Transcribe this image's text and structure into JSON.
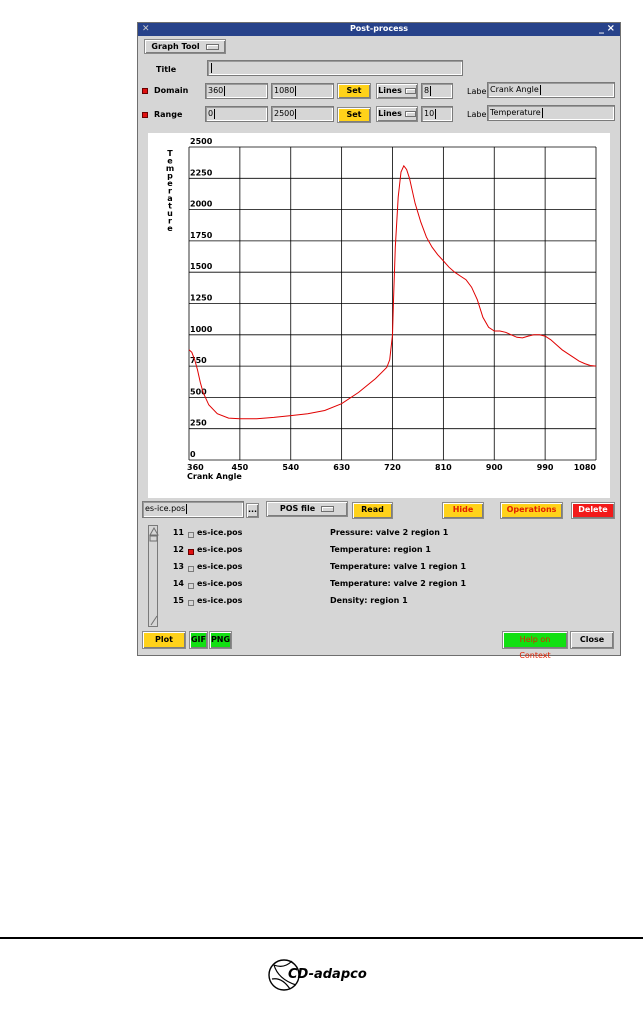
{
  "window": {
    "title": "Post-process",
    "min_glyph": "_",
    "close_glyph": "×"
  },
  "tool_selector": {
    "label": "Graph Tool"
  },
  "title_row": {
    "label": "Title",
    "value": ""
  },
  "domain_row": {
    "label": "Domain",
    "min": "360",
    "max": "1080",
    "set_label": "Set",
    "lines_label": "Lines",
    "lines_value": "8",
    "label_caption": "Label",
    "axis_label": "Crank Angle"
  },
  "range_row": {
    "label": "Range",
    "min": "0",
    "max": "2500",
    "set_label": "Set",
    "lines_label": "Lines",
    "lines_value": "10",
    "label_caption": "Label",
    "axis_label": "Temperature"
  },
  "chart_data": {
    "type": "line",
    "xlabel": "Crank Angle",
    "ylabel": "Temperature",
    "xlim": [
      360,
      1080
    ],
    "ylim": [
      0,
      2500
    ],
    "xticks": [
      360,
      450,
      540,
      630,
      720,
      810,
      900,
      990,
      1080
    ],
    "yticks": [
      0,
      250,
      500,
      750,
      1000,
      1250,
      1500,
      1750,
      2000,
      2250,
      2500
    ],
    "grid": true,
    "series": [
      {
        "color": "#e00000",
        "x": [
          360,
          365,
          370,
          375,
          380,
          385,
          395,
          410,
          430,
          450,
          480,
          510,
          540,
          570,
          600,
          630,
          660,
          690,
          710,
          715,
          720,
          722,
          725,
          730,
          735,
          740,
          745,
          750,
          755,
          760,
          770,
          780,
          790,
          800,
          810,
          820,
          830,
          840,
          850,
          860,
          870,
          880,
          890,
          900,
          910,
          920,
          930,
          940,
          950,
          960,
          970,
          980,
          990,
          1000,
          1010,
          1020,
          1030,
          1040,
          1050,
          1060,
          1070,
          1080
        ],
        "y": [
          880,
          860,
          800,
          720,
          620,
          540,
          440,
          370,
          335,
          330,
          330,
          340,
          355,
          370,
          395,
          450,
          540,
          650,
          740,
          800,
          1000,
          1300,
          1700,
          2100,
          2300,
          2350,
          2320,
          2250,
          2150,
          2050,
          1900,
          1780,
          1700,
          1640,
          1590,
          1540,
          1500,
          1470,
          1440,
          1380,
          1280,
          1140,
          1060,
          1030,
          1030,
          1020,
          1000,
          980,
          975,
          990,
          1000,
          1000,
          990,
          960,
          920,
          880,
          850,
          820,
          790,
          770,
          755,
          750
        ]
      }
    ]
  },
  "file_row": {
    "file_value": "es-ice.pos",
    "browse_label": "...",
    "type_label": "POS file",
    "read_label": "Read",
    "hide_label": "Hide",
    "operations_label": "Operations",
    "delete_label": "Delete"
  },
  "list_items": [
    {
      "num": "11",
      "checked": false,
      "file": "es-ice.pos",
      "desc": "Pressure: valve 2 region 1"
    },
    {
      "num": "12",
      "checked": true,
      "file": "es-ice.pos",
      "desc": "Temperature: region 1"
    },
    {
      "num": "13",
      "checked": false,
      "file": "es-ice.pos",
      "desc": "Temperature: valve 1 region 1"
    },
    {
      "num": "14",
      "checked": false,
      "file": "es-ice.pos",
      "desc": "Temperature: valve 2 region 1"
    },
    {
      "num": "15",
      "checked": false,
      "file": "es-ice.pos",
      "desc": "Density: region 1"
    }
  ],
  "bottom_bar": {
    "plot_label": "Plot",
    "gif_label": "GIF",
    "png_label": "PNG",
    "help_label": "Help on Context",
    "close_label": "Close"
  },
  "footer": {
    "logo_text": "CD-adapco"
  }
}
